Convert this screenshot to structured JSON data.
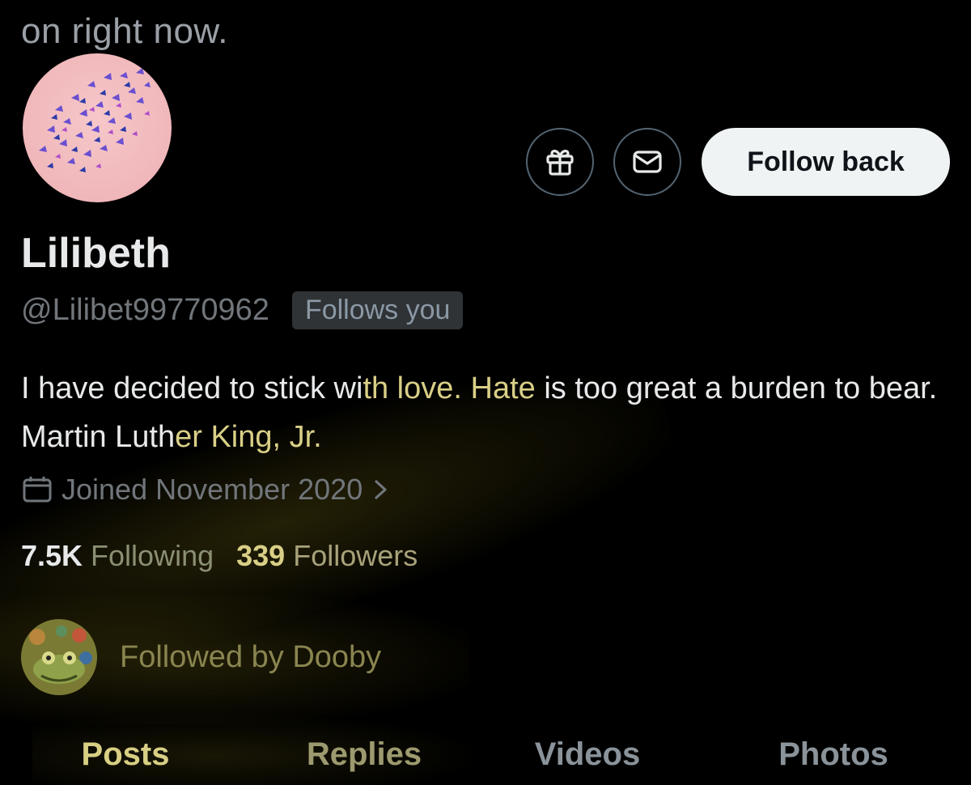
{
  "header": {
    "top_text": "on right now."
  },
  "actions": {
    "gift_icon": "gift-icon",
    "message_icon": "envelope-icon",
    "follow_back_label": "Follow back"
  },
  "profile": {
    "name": "Lilibeth",
    "handle": "@Lilibet99770962",
    "follows_you_badge": "Follows you",
    "bio_parts": {
      "p1": "I have decided to stick wi",
      "p2": "th love. Hate",
      "p3": " is too great a burden to bear. Martin Luth",
      "p4": "er King, Jr."
    },
    "joined": "Joined November 2020"
  },
  "stats": {
    "following_count": "7.5K",
    "following_label": "Following",
    "followers_count": "339",
    "followers_label": "Followers"
  },
  "followed_by": {
    "text": "Followed by Dooby"
  },
  "tabs": [
    {
      "label": "Posts"
    },
    {
      "label": "Replies"
    },
    {
      "label": "Videos"
    },
    {
      "label": "Photos"
    }
  ],
  "colors": {
    "background": "#000000",
    "highlight": "#d9cf86",
    "button_bg": "#eff3f4",
    "muted": "#71767b"
  }
}
